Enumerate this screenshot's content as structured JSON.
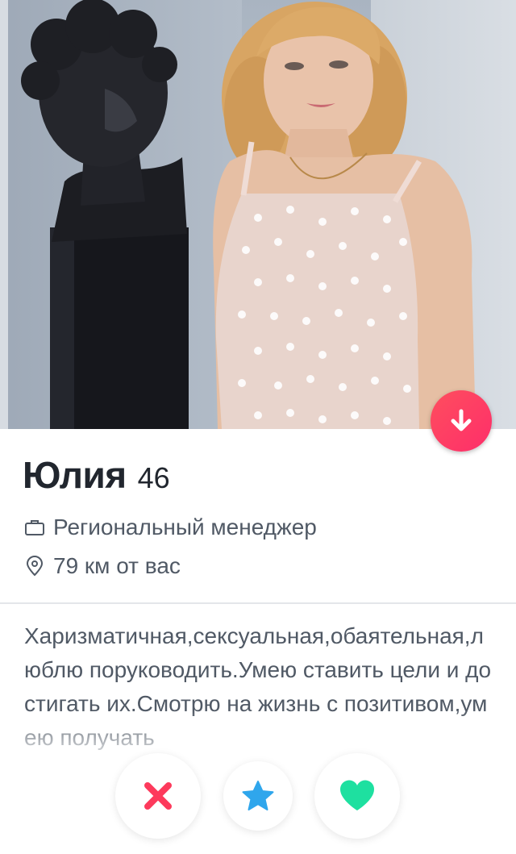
{
  "profile": {
    "name": "Юлия",
    "age": "46",
    "job": "Региональный менеджер",
    "distance": "79 км от вас",
    "bio": "Харизматичная,сексуальная,обаятельная,люблю поруководить.Умею ставить цели и достигать их.Смотрю на жизнь с позитивом,умею получать"
  },
  "icons": {
    "job": "briefcase-icon",
    "distance": "location-pin-icon",
    "collapse": "arrow-down-icon",
    "nope": "x-icon",
    "super_like": "star-icon",
    "like": "heart-icon"
  },
  "colors": {
    "fab_gradient_start": "#ff4e5e",
    "fab_gradient_end": "#fd2e6a",
    "nope": "#fd3a5c",
    "super_like": "#2fa6ec",
    "like": "#1ee0a0",
    "name_text": "#21262e",
    "secondary_text": "#505965"
  }
}
